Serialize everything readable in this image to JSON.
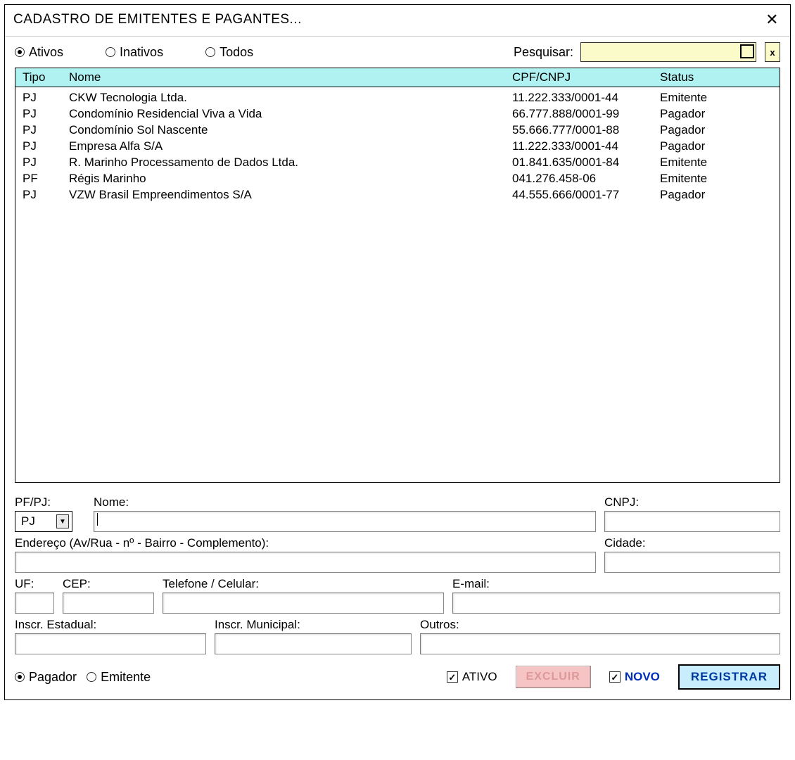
{
  "window": {
    "title": "CADASTRO DE EMITENTES E PAGANTES..."
  },
  "filters": {
    "ativos": "Ativos",
    "inativos": "Inativos",
    "todos": "Todos",
    "selected": "ativos"
  },
  "search": {
    "label": "Pesquisar:",
    "value": "",
    "clear_label": "x"
  },
  "grid": {
    "headers": {
      "tipo": "Tipo",
      "nome": "Nome",
      "cpf": "CPF/CNPJ",
      "status": "Status"
    },
    "rows": [
      {
        "tipo": "PJ",
        "nome": "CKW Tecnologia Ltda.",
        "cpf": "11.222.333/0001-44",
        "status": "Emitente"
      },
      {
        "tipo": "PJ",
        "nome": "Condomínio Residencial Viva a Vida",
        "cpf": "66.777.888/0001-99",
        "status": "Pagador"
      },
      {
        "tipo": "PJ",
        "nome": "Condomínio Sol Nascente",
        "cpf": "55.666.777/0001-88",
        "status": "Pagador"
      },
      {
        "tipo": "PJ",
        "nome": "Empresa Alfa S/A",
        "cpf": "11.222.333/0001-44",
        "status": "Pagador"
      },
      {
        "tipo": "PJ",
        "nome": "R. Marinho Processamento de Dados Ltda.",
        "cpf": "01.841.635/0001-84",
        "status": "Emitente"
      },
      {
        "tipo": "PF",
        "nome": "Régis Marinho",
        "cpf": "041.276.458-06",
        "status": "Emitente"
      },
      {
        "tipo": "PJ",
        "nome": "VZW Brasil Empreendimentos S/A",
        "cpf": "44.555.666/0001-77",
        "status": "Pagador"
      }
    ]
  },
  "form": {
    "pfpj_label": "PF/PJ:",
    "pfpj_value": "PJ",
    "nome_label": "Nome:",
    "nome_value": "",
    "cnpj_label": "CNPJ:",
    "cnpj_value": "",
    "endereco_label": "Endereço (Av/Rua - nº - Bairro - Complemento):",
    "endereco_value": "",
    "cidade_label": "Cidade:",
    "cidade_value": "",
    "uf_label": "UF:",
    "uf_value": "",
    "cep_label": "CEP:",
    "cep_value": "",
    "tel_label": "Telefone / Celular:",
    "tel_value": "",
    "email_label": "E-mail:",
    "email_value": "",
    "inscr_est_label": "Inscr. Estadual:",
    "inscr_est_value": "",
    "inscr_mun_label": "Inscr. Municipal:",
    "inscr_mun_value": "",
    "outros_label": "Outros:",
    "outros_value": ""
  },
  "bottom": {
    "pagador": "Pagador",
    "emitente": "Emitente",
    "role_selected": "pagador",
    "ativo_label": "ATIVO",
    "ativo_checked": true,
    "excluir": "EXCLUIR",
    "novo_label": "NOVO",
    "novo_checked": true,
    "registrar": "REGISTRAR"
  }
}
